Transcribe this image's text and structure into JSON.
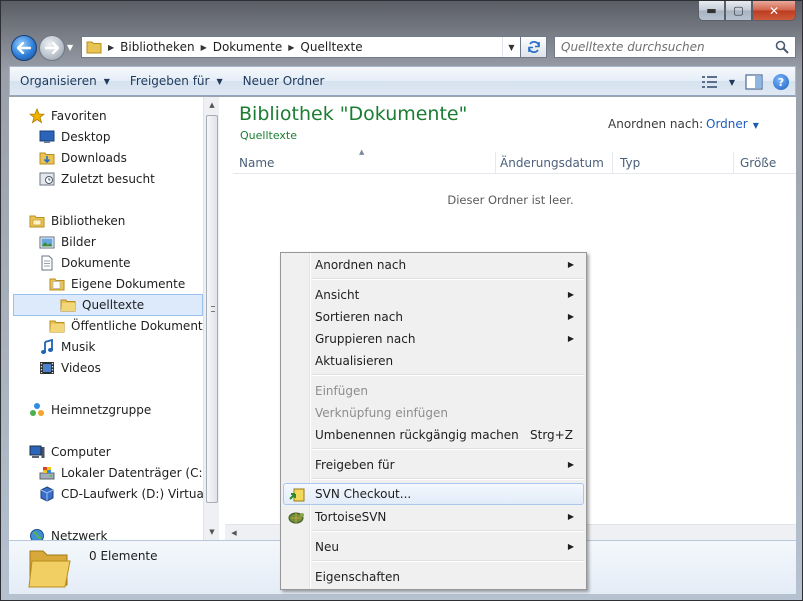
{
  "window": {
    "caption_buttons": {
      "minimize": "▬",
      "maximize": "▢",
      "close": "✕"
    }
  },
  "address": {
    "crumbs": [
      "Bibliotheken",
      "Dokumente",
      "Quelltexte"
    ],
    "search_placeholder": "Quelltexte durchsuchen"
  },
  "toolbar": {
    "organize": "Organisieren",
    "share": "Freigeben für",
    "new_folder": "Neuer Ordner"
  },
  "nav": {
    "favorites": "Favoriten",
    "desktop": "Desktop",
    "downloads": "Downloads",
    "recent": "Zuletzt besucht",
    "libraries": "Bibliotheken",
    "pictures": "Bilder",
    "documents": "Dokumente",
    "my_documents": "Eigene Dokumente",
    "sources": "Quelltexte",
    "public_documents": "Öffentliche Dokumente",
    "music": "Musik",
    "videos": "Videos",
    "homegroup": "Heimnetzgruppe",
    "computer": "Computer",
    "local_disk": "Lokaler Datenträger (C:)",
    "cd_drive": "CD-Laufwerk (D:) VirtualBox Guest Additions",
    "network": "Netzwerk"
  },
  "main": {
    "title": "Bibliothek \"Dokumente\"",
    "subtitle": "Quelltexte",
    "arrange_label": "Anordnen nach:",
    "arrange_value": "Ordner",
    "columns": [
      "Name",
      "Änderungsdatum",
      "Typ",
      "Größe"
    ],
    "empty_message": "Dieser Ordner ist leer."
  },
  "details": {
    "count": "0 Elemente"
  },
  "context_menu": {
    "arrange_by": "Anordnen nach",
    "view": "Ansicht",
    "sort_by": "Sortieren nach",
    "group_by": "Gruppieren nach",
    "refresh": "Aktualisieren",
    "paste": "Einfügen",
    "paste_shortcut": "Verknüpfung einfügen",
    "undo_rename": "Umbenennen rückgängig machen",
    "undo_accel": "Strg+Z",
    "share_with": "Freigeben für",
    "svn_checkout": "SVN Checkout...",
    "tortoise": "TortoiseSVN",
    "new": "Neu",
    "properties": "Eigenschaften"
  },
  "colors": {
    "library_green": "#1b7d32",
    "link_blue": "#1c5dba",
    "selection": "#dceafc"
  }
}
